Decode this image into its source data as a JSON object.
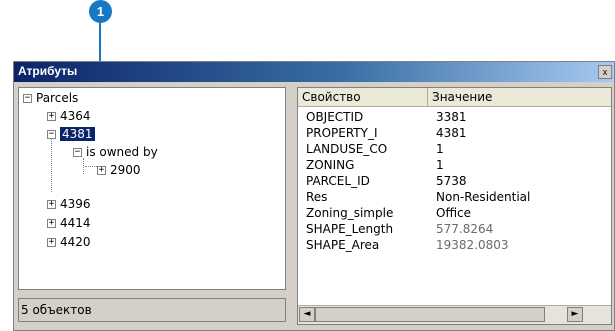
{
  "callout": {
    "number": "1"
  },
  "window": {
    "title": "Атрибуты",
    "close_label": "x"
  },
  "tree": {
    "root": "Parcels",
    "items": [
      {
        "label": "4364",
        "expander": "+"
      },
      {
        "label": "4381",
        "expander": "−"
      },
      {
        "label": "is owned by",
        "expander": "−"
      },
      {
        "label": "2900",
        "expander": "+"
      },
      {
        "label": "4396",
        "expander": "+"
      },
      {
        "label": "4414",
        "expander": "+"
      },
      {
        "label": "4420",
        "expander": "+"
      }
    ],
    "root_expander": "−"
  },
  "status": {
    "text": "5 объектов"
  },
  "properties": {
    "headers": {
      "property": "Свойство",
      "value": "Значение"
    },
    "rows": [
      {
        "key": "OBJECTID",
        "value": "3381"
      },
      {
        "key": "PROPERTY_I",
        "value": "4381"
      },
      {
        "key": "LANDUSE_CO",
        "value": "1"
      },
      {
        "key": "ZONING",
        "value": "1"
      },
      {
        "key": "PARCEL_ID",
        "value": "5738"
      },
      {
        "key": "Res",
        "value": "Non-Residential"
      },
      {
        "key": "Zoning_simple",
        "value": "Office"
      },
      {
        "key": "SHAPE_Length",
        "value": "577.8264"
      },
      {
        "key": "SHAPE_Area",
        "value": "19382.0803"
      }
    ]
  },
  "scroll": {
    "left_arrow": "◄",
    "right_arrow": "►"
  }
}
